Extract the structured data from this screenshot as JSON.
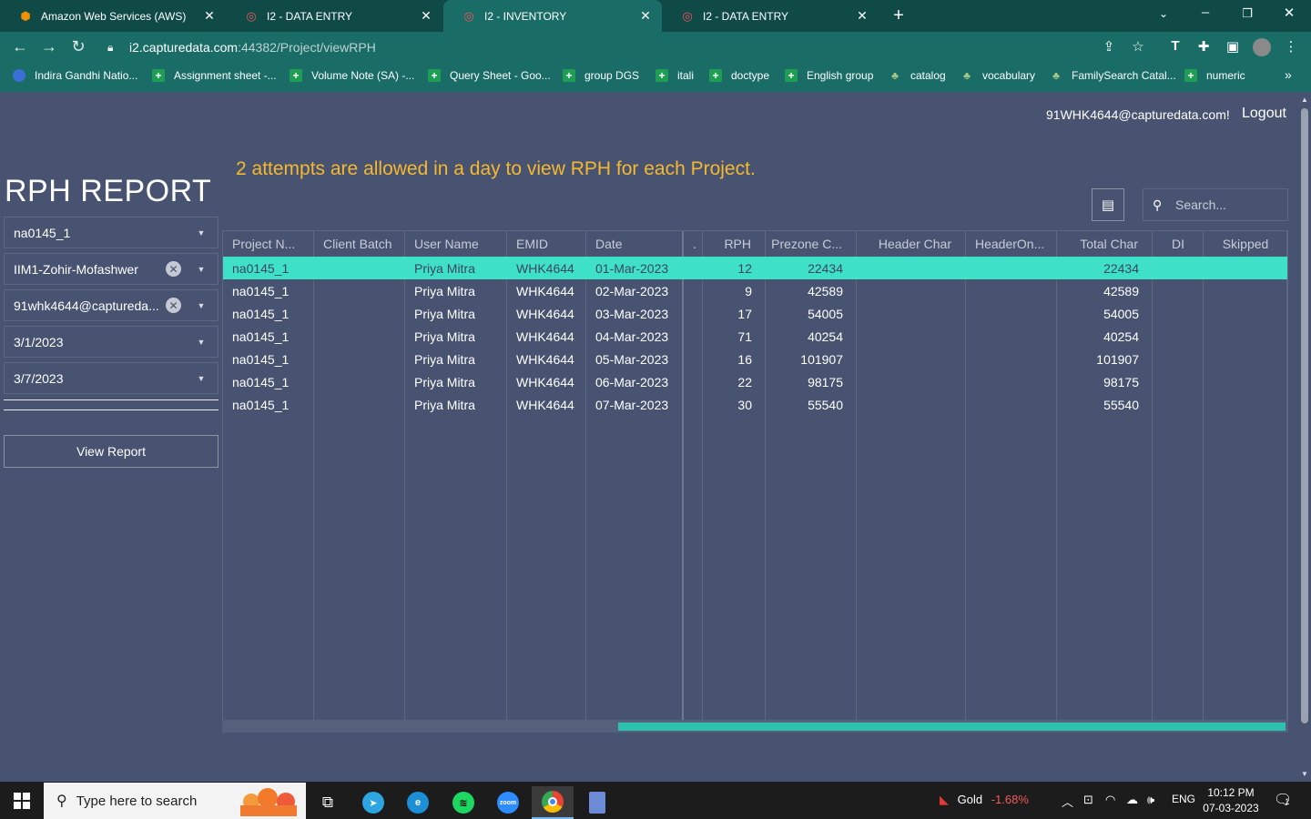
{
  "browser": {
    "tabs": [
      {
        "title": "Amazon Web Services (AWS)",
        "icon": "aws-icon",
        "active": false
      },
      {
        "title": "I2 - DATA ENTRY",
        "icon": "i2-icon",
        "active": false
      },
      {
        "title": "I2 - INVENTORY",
        "icon": "i2-icon",
        "active": true
      },
      {
        "title": "I2 - DATA ENTRY",
        "icon": "i2-icon",
        "active": false
      }
    ],
    "url_host": "i2.capturedata.com",
    "url_rest": ":44382/Project/viewRPH",
    "bookmarks": [
      {
        "label": "Indira Gandhi Natio...",
        "icon": "globe-icon"
      },
      {
        "label": "Assignment sheet -...",
        "icon": "sheets-icon"
      },
      {
        "label": "Volume Note (SA) -...",
        "icon": "sheets-icon"
      },
      {
        "label": "Query Sheet - Goo...",
        "icon": "sheets-icon"
      },
      {
        "label": "group DGS",
        "icon": "sheets-icon"
      },
      {
        "label": "itali",
        "icon": "sheets-icon"
      },
      {
        "label": "doctype",
        "icon": "sheets-icon"
      },
      {
        "label": "English group",
        "icon": "sheets-icon"
      },
      {
        "label": "catalog",
        "icon": "leaf-icon"
      },
      {
        "label": "vocabulary",
        "icon": "leaf-icon"
      },
      {
        "label": "FamilySearch Catal...",
        "icon": "leaf-icon"
      },
      {
        "label": "numeric",
        "icon": "sheets-icon"
      }
    ],
    "bookmarks_overflow": "»"
  },
  "header": {
    "user_email": "91WHK4644@capturedata.com!",
    "logout_label": "Logout"
  },
  "notice": "2 attempts are allowed in a day to view RPH for each Project.",
  "sidebar": {
    "title": "RPH REPORT",
    "project": "na0145_1",
    "batch": "IIM1-Zohir-Mofashwer",
    "user": "91whk4644@captureda...",
    "from_date": "3/1/2023",
    "to_date": "3/7/2023",
    "view_report_label": "View Report"
  },
  "search": {
    "placeholder": "Search..."
  },
  "grid": {
    "columns": [
      "Project N...",
      "Client Batch",
      "User Name",
      "EMID",
      "Date",
      ".",
      "RPH",
      "Prezone C...",
      "Header Char",
      "HeaderOn...",
      "Total Char",
      "DI",
      "Skipped"
    ],
    "rows": [
      [
        "na0145_1",
        "",
        "Priya Mitra",
        "WHK4644",
        "01-Mar-2023",
        "",
        "12",
        "22434",
        "",
        "",
        "22434",
        "",
        ""
      ],
      [
        "na0145_1",
        "",
        "Priya Mitra",
        "WHK4644",
        "02-Mar-2023",
        "",
        "9",
        "42589",
        "",
        "",
        "42589",
        "",
        ""
      ],
      [
        "na0145_1",
        "",
        "Priya Mitra",
        "WHK4644",
        "03-Mar-2023",
        "",
        "17",
        "54005",
        "",
        "",
        "54005",
        "",
        ""
      ],
      [
        "na0145_1",
        "",
        "Priya Mitra",
        "WHK4644",
        "04-Mar-2023",
        "",
        "71",
        "40254",
        "",
        "",
        "40254",
        "",
        ""
      ],
      [
        "na0145_1",
        "",
        "Priya Mitra",
        "WHK4644",
        "05-Mar-2023",
        "",
        "16",
        "101907",
        "",
        "",
        "101907",
        "",
        ""
      ],
      [
        "na0145_1",
        "",
        "Priya Mitra",
        "WHK4644",
        "06-Mar-2023",
        "",
        "22",
        "98175",
        "",
        "",
        "98175",
        "",
        ""
      ],
      [
        "na0145_1",
        "",
        "Priya Mitra",
        "WHK4644",
        "07-Mar-2023",
        "",
        "30",
        "55540",
        "",
        "",
        "55540",
        "",
        ""
      ]
    ],
    "selected_row": 0,
    "horizontal_scroll_fraction": 0.37
  },
  "taskbar": {
    "search_placeholder": "Type here to search",
    "gold_label": "Gold",
    "gold_change": "-1.68%",
    "language": "ENG",
    "time": "10:12 PM",
    "date": "07-03-2023",
    "notification_count": "1"
  },
  "colors": {
    "page_bg": "#475370",
    "browser_frame": "#1a6c66",
    "selected_row": "#3fe0c8",
    "notice": "#f5b82e",
    "scroll_thumb": "#2dc2ae"
  }
}
